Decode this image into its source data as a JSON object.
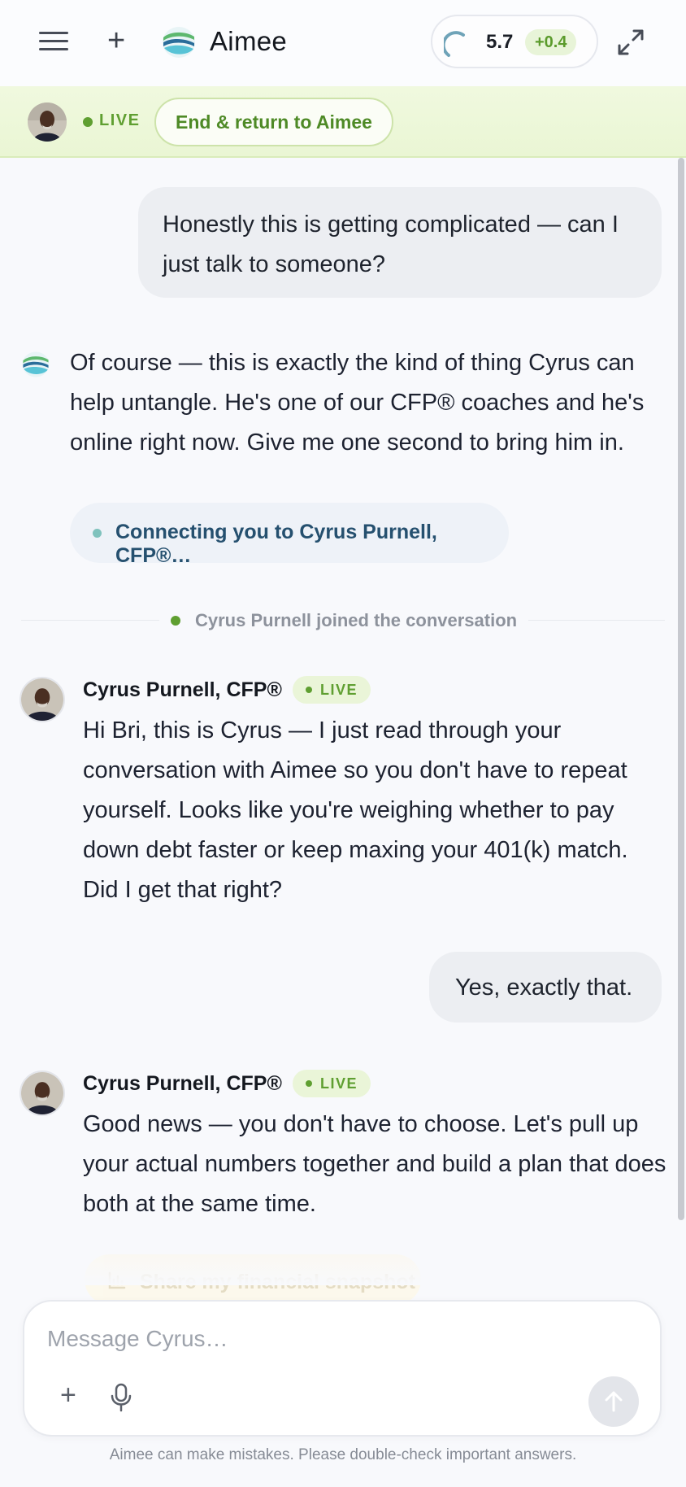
{
  "header": {
    "brand": "Aimee",
    "score": "5.7",
    "score_delta": "+0.4",
    "score_progress": 0.57
  },
  "banner": {
    "live_label": "LIVE",
    "end_button": "End & return to Aimee"
  },
  "messages": {
    "user_1": "Honestly this is getting complicated — can I just talk to someone?",
    "ai_1": "Of course — this is exactly the kind of thing Cyrus can help untangle. He's one of our CFP® coaches and he's online right now. Give me one second to bring him in.",
    "connecting": "Connecting you to Cyrus Purnell, CFP®…",
    "joined": "Cyrus Purnell joined the conversation",
    "coach_1_name": "Cyrus Purnell, CFP®",
    "coach_1_live": "LIVE",
    "coach_1_text": "Hi Bri, this is Cyrus — I just read through your conversation with Aimee so you don't have to repeat yourself. Looks like you're weighing whether to pay down debt faster or keep maxing your 401(k) match. Did I get that right?",
    "user_2": "Yes, exactly that.",
    "coach_2_name": "Cyrus Purnell, CFP®",
    "coach_2_live": "LIVE",
    "coach_2_text": "Good news — you don't have to choose. Let's pull up your actual numbers together and build a plan that does both at the same time.",
    "share_button": "Share my financial snapshot"
  },
  "composer": {
    "placeholder": "Message Cyrus…",
    "value": ""
  },
  "footer": {
    "disclaimer": "Aimee can make mistakes. Please double-check important answers."
  },
  "colors": {
    "accent_green": "#5f9f31",
    "banner_bg": "#eef8dc",
    "connecting_text": "#25506f"
  }
}
